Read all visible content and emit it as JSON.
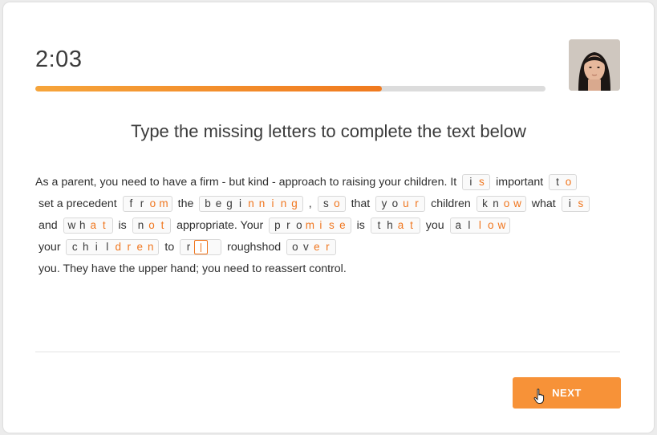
{
  "timer": "2:03",
  "progress": 0.68,
  "instruction": "Type the missing letters to complete the text below",
  "passage": [
    {
      "t": "As a parent, you need to have a firm - but kind - approach to raising your children. It "
    },
    {
      "w": [
        "i",
        "s"
      ],
      "g": 1
    },
    {
      "t": " important "
    },
    {
      "w": [
        "t",
        "o"
      ],
      "g": 1
    },
    {
      "t": " set a precedent "
    },
    {
      "w": [
        "f",
        "r",
        "o",
        "m"
      ],
      "g": 2
    },
    {
      "t": " the "
    },
    {
      "w": [
        "b",
        "e",
        "g",
        "i",
        "n",
        "n",
        "i",
        "n",
        "g"
      ],
      "g": 4
    },
    {
      "t": " , "
    },
    {
      "w": [
        "s",
        "o"
      ],
      "g": 1
    },
    {
      "t": " that "
    },
    {
      "w": [
        "y",
        "o",
        "u",
        "r"
      ],
      "g": 2
    },
    {
      "t": " children "
    },
    {
      "w": [
        "k",
        "n",
        "o",
        "w"
      ],
      "g": 2
    },
    {
      "t": " what "
    },
    {
      "w": [
        "i",
        "s"
      ],
      "g": 1
    },
    {
      "t": " and "
    },
    {
      "w": [
        "w",
        "h",
        "a",
        "t"
      ],
      "g": 2
    },
    {
      "t": " is "
    },
    {
      "w": [
        "n",
        "o",
        "t"
      ],
      "g": 1
    },
    {
      "t": " appropriate. Your "
    },
    {
      "w": [
        "p",
        "r",
        "o",
        "m",
        "i",
        "s",
        "e"
      ],
      "g": 3
    },
    {
      "t": " is "
    },
    {
      "w": [
        "t",
        "h",
        "a",
        "t"
      ],
      "g": 2
    },
    {
      "t": " you "
    },
    {
      "w": [
        "a",
        "l",
        "l",
        "o",
        "w"
      ],
      "g": 2
    },
    {
      "t": " your "
    },
    {
      "w": [
        "c",
        "h",
        "i",
        "l",
        "d",
        "r",
        "e",
        "n"
      ],
      "g": 4
    },
    {
      "t": " to "
    },
    {
      "w": [
        "r",
        "",
        ""
      ],
      "g": 1,
      "cursor": 1
    },
    {
      "t": " roughshod "
    },
    {
      "w": [
        "o",
        "v",
        "e",
        "r"
      ],
      "g": 2
    },
    {
      "t": " you. They have the upper hand; you need to reassert control."
    }
  ],
  "next_label": "NEXT",
  "colors": {
    "accent": "#f0761e",
    "button": "#f79238"
  }
}
